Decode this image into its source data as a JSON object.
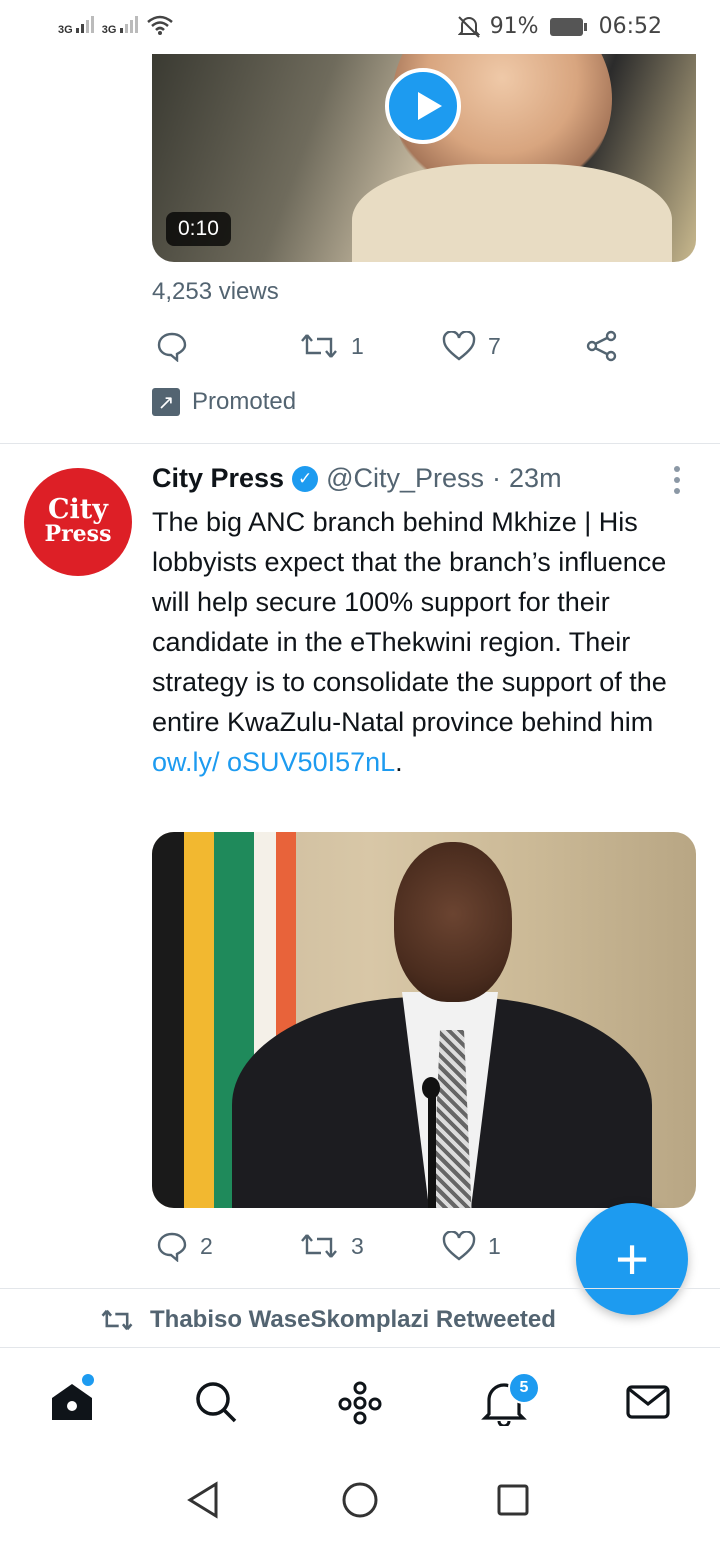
{
  "status_bar": {
    "signal_1": "3G",
    "signal_2": "3G",
    "battery": "91%",
    "time": "06:52",
    "icons": [
      "wifi-icon",
      "mute-bell-icon",
      "battery-icon"
    ]
  },
  "promoted_tweet": {
    "video_duration": "0:10",
    "views": "4,253 views",
    "reply_count": "",
    "retweet_count": "1",
    "like_count": "7",
    "promoted_label": "Promoted"
  },
  "tweet": {
    "avatar_line1": "City",
    "avatar_line2": "Press",
    "display_name": "City Press",
    "handle": "@City_Press",
    "separator": "·",
    "time": "23m",
    "text": "The big ANC branch behind Mkhize | His lobbyists expect that the branch’s influence will help secure 100% support for their candidate in the eThekwini region. Their strategy is to consolidate the support of the entire KwaZulu-Natal province behind him ",
    "link_text": "ow.ly/ oSUV50I57nL",
    "link_suffix": ".",
    "reply_count": "2",
    "retweet_count": "3",
    "like_count": "1"
  },
  "next_item": {
    "retweeted_label": "Thabiso WaseSkomplazi Retweeted"
  },
  "fab": {
    "icon": "compose-plus-icon",
    "label": "+"
  },
  "bottom_nav": {
    "items": [
      "home-icon",
      "search-icon",
      "spaces-icon",
      "notifications-icon",
      "messages-icon"
    ],
    "notifications_badge": "5"
  },
  "colors": {
    "accent": "#1d9bf0",
    "muted": "#536471",
    "avatar_red": "#dd1f26"
  }
}
